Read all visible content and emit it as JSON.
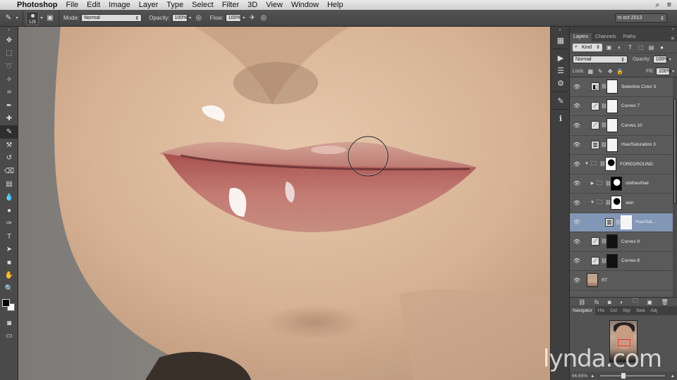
{
  "menubar": {
    "apple_icon": "apple-icon",
    "items": [
      "Photoshop",
      "File",
      "Edit",
      "Image",
      "Layer",
      "Type",
      "Select",
      "Filter",
      "3D",
      "View",
      "Window",
      "Help"
    ]
  },
  "options": {
    "brush_size": "125",
    "mode_label": "Mode:",
    "mode_value": "Normal",
    "opacity_label": "Opacity:",
    "opacity_value": "100%",
    "flow_label": "Flow:",
    "flow_value": "100%",
    "workspace": "ts oct 2013"
  },
  "layers_panel": {
    "tabs": [
      "Layers",
      "Channels",
      "Paths"
    ],
    "kind_label": "Kind",
    "blend_mode": "Normal",
    "opacity_label": "Opacity:",
    "opacity_value": "100%",
    "lock_label": "Lock:",
    "fill_label": "Fill:",
    "fill_value": "100%",
    "layers": [
      {
        "name": "Selective Color 3",
        "type": "adjustment",
        "indent": 0,
        "mask": "white"
      },
      {
        "name": "Curves 7",
        "type": "adjustment",
        "indent": 0,
        "mask": "white"
      },
      {
        "name": "Curves 10",
        "type": "adjustment",
        "indent": 0,
        "mask": "white"
      },
      {
        "name": "Hue/Saturation 3",
        "type": "adjustment",
        "indent": 0,
        "mask": "white"
      },
      {
        "name": "FOREGROUND",
        "type": "group",
        "indent": 0,
        "mask": "silhouette",
        "expanded": true
      },
      {
        "name": "clothes/hair",
        "type": "group",
        "indent": 1,
        "mask": "silhouette",
        "expanded": false
      },
      {
        "name": "skin",
        "type": "group",
        "indent": 1,
        "mask": "silhouette",
        "expanded": true
      },
      {
        "name": "Hue/Sat...",
        "type": "adjustment",
        "indent": 2,
        "mask": "white",
        "selected": true
      },
      {
        "name": "Curves 9",
        "type": "adjustment",
        "indent": 0,
        "mask": "black"
      },
      {
        "name": "Curves 8",
        "type": "adjustment",
        "indent": 0,
        "mask": "black"
      },
      {
        "name": "RT",
        "type": "photo",
        "indent": 0
      }
    ]
  },
  "navigator": {
    "tabs": [
      "Navigator",
      "His",
      "Col",
      "Styl",
      "Swa",
      "Adj"
    ],
    "zoom": "66.65%",
    "zoom_fraction": 0.32
  },
  "watermark": "lynda.com",
  "colors": {
    "selected_layer": "#8296b5",
    "panel_bg": "#535353"
  }
}
